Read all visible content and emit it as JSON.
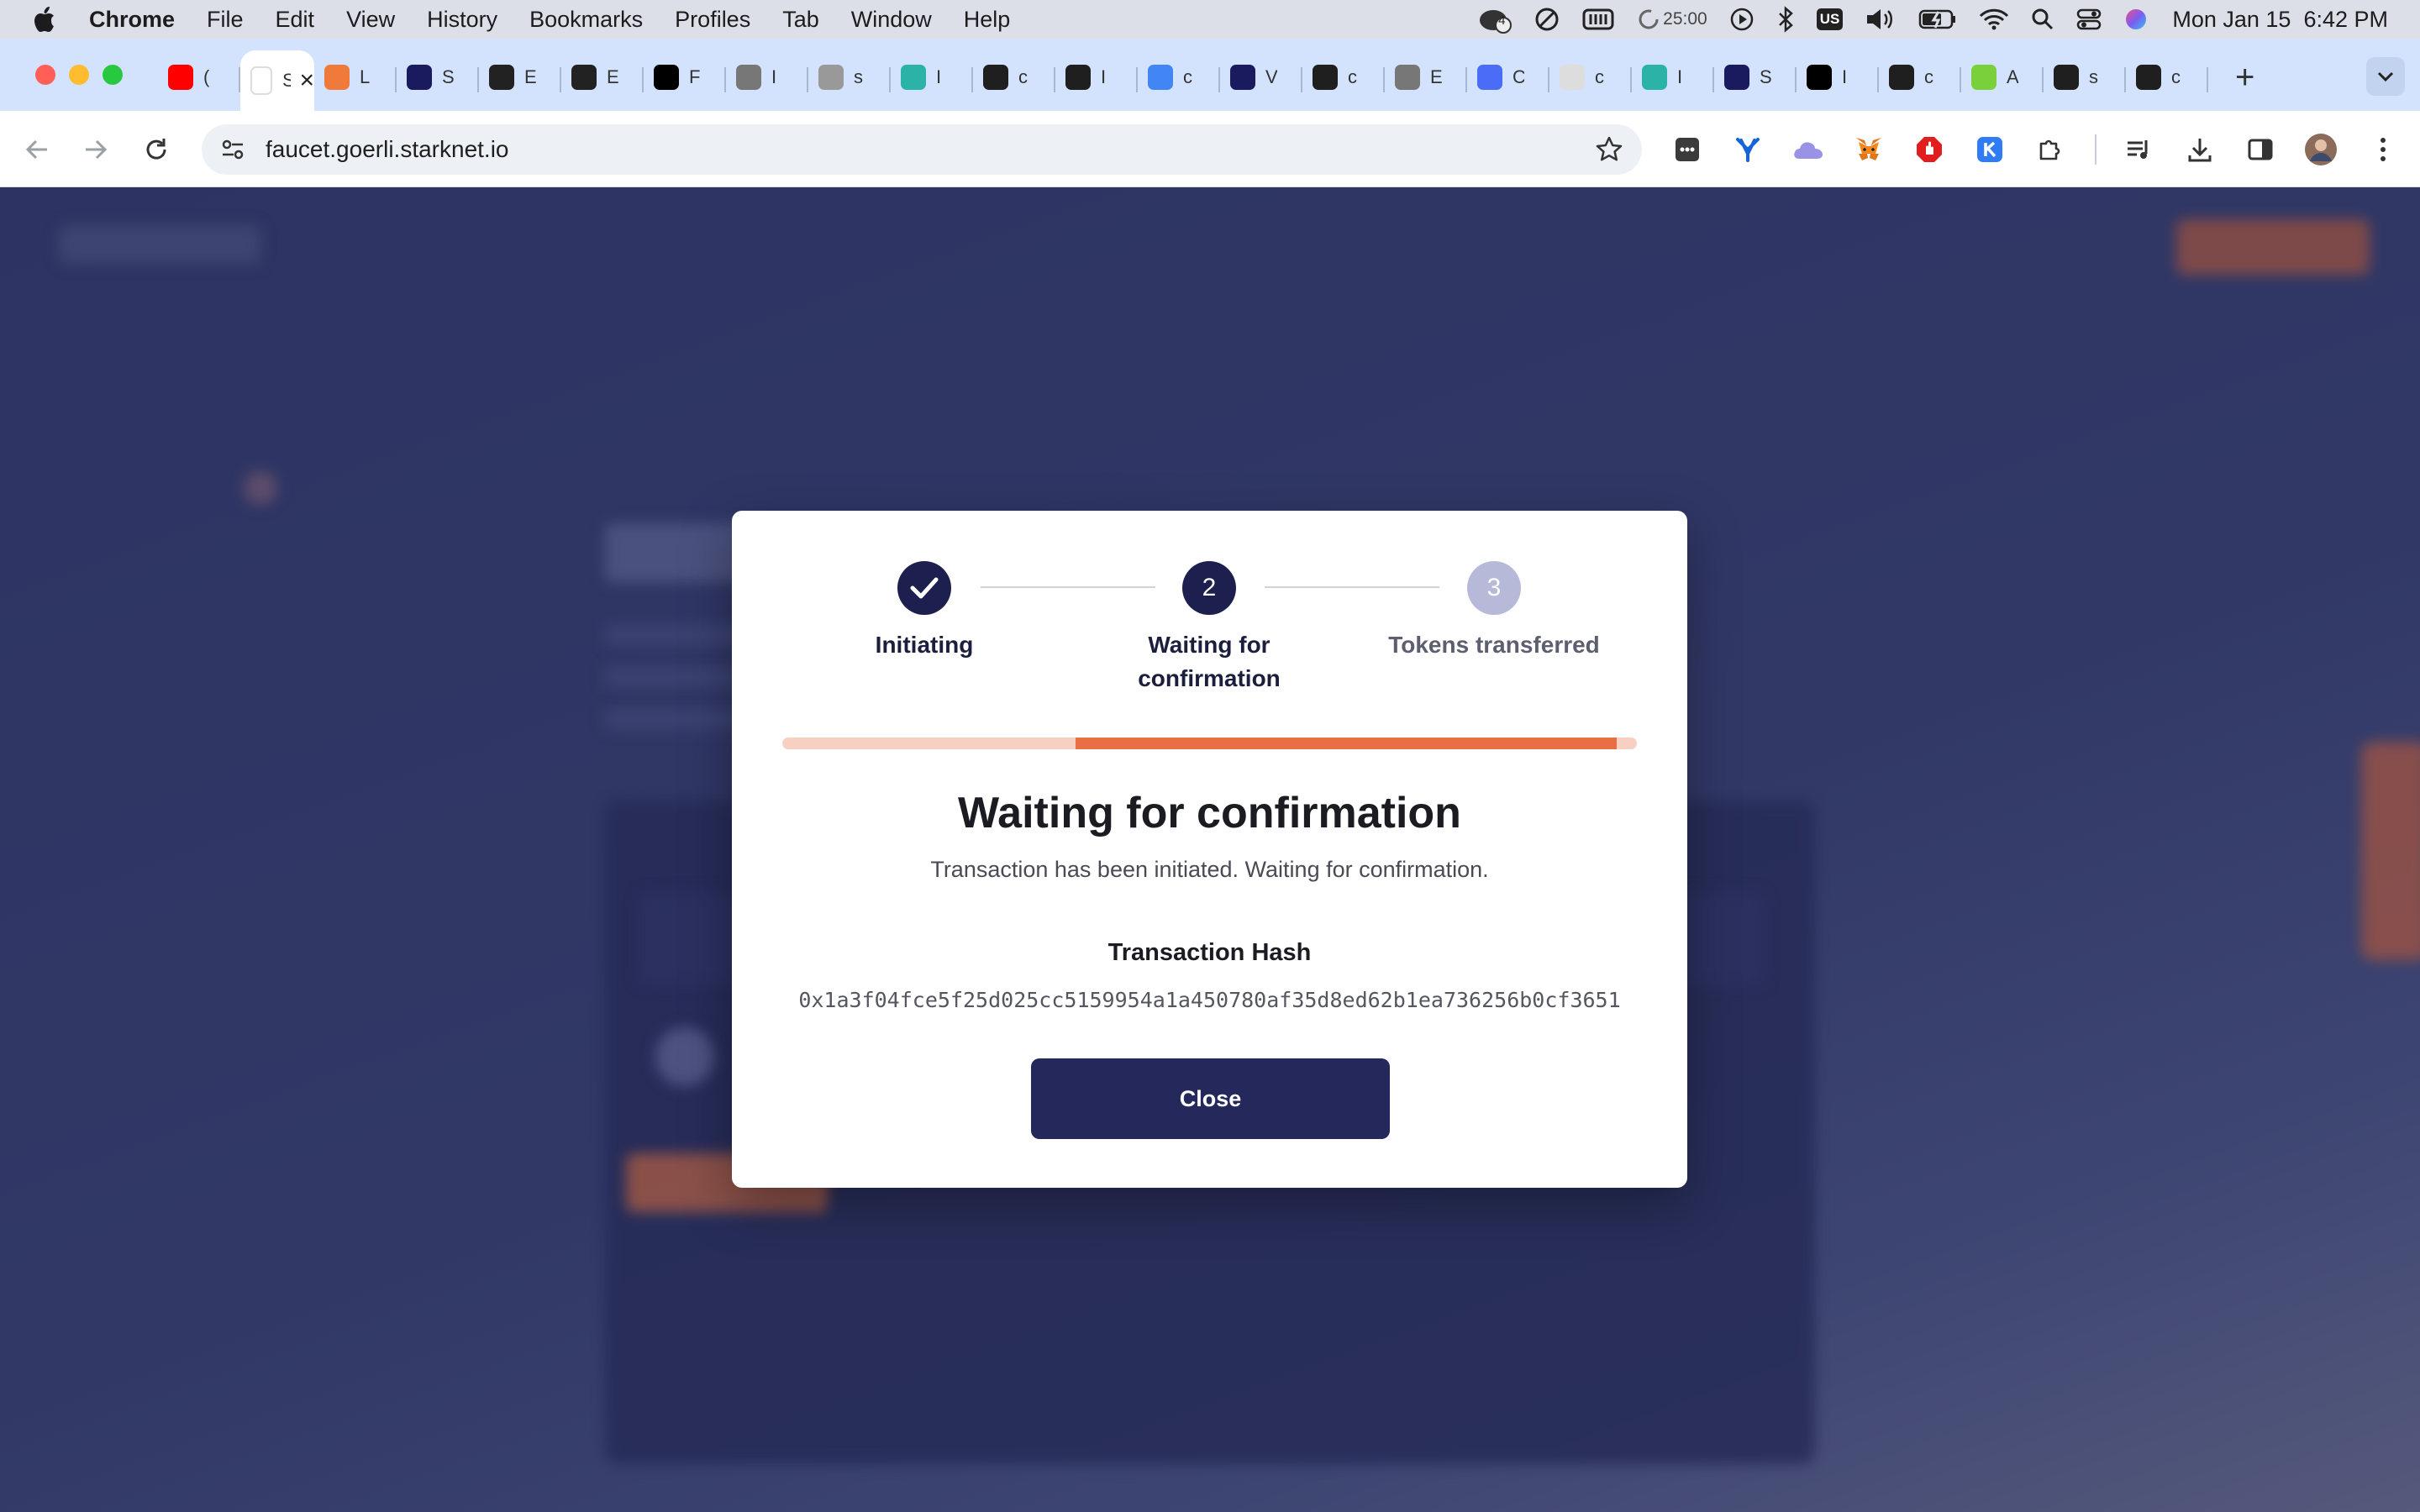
{
  "menubar": {
    "app": "Chrome",
    "items": [
      "File",
      "Edit",
      "View",
      "History",
      "Bookmarks",
      "Profiles",
      "Tab",
      "Window",
      "Help"
    ],
    "timer": "25:00",
    "badge_count": "4",
    "keyboard_layout": "US",
    "datetime": "Mon Jan 15  6:42 PM"
  },
  "tabs": [
    {
      "icon": "youtube-icon",
      "label": "(",
      "color": "#ff0000"
    },
    {
      "icon": "starknet-icon",
      "label": "S",
      "active": true
    },
    {
      "icon": "arbitrum-icon",
      "label": "L",
      "color": "#f07a3a"
    },
    {
      "icon": "starknet-icon",
      "label": "S",
      "color": "#1a1a5e"
    },
    {
      "icon": "eth-icon",
      "label": "E",
      "color": "#222222"
    },
    {
      "icon": "eth-icon",
      "label": "E",
      "color": "#222222"
    },
    {
      "icon": "nft-storage-icon",
      "label": "F",
      "color": "#000000"
    },
    {
      "icon": "globe-icon",
      "label": "I",
      "color": "#777777"
    },
    {
      "icon": "globe-icon",
      "label": "s",
      "color": "#999999"
    },
    {
      "icon": "moralis-icon",
      "label": "I",
      "color": "#2ab3a6"
    },
    {
      "icon": "github-icon",
      "label": "c",
      "color": "#1f1f1f"
    },
    {
      "icon": "github-icon",
      "label": "I",
      "color": "#1f1f1f"
    },
    {
      "icon": "google-icon",
      "label": "c",
      "color": "#4285f4"
    },
    {
      "icon": "wallet-icon",
      "label": "V",
      "color": "#1a1a5e"
    },
    {
      "icon": "github-icon",
      "label": "c",
      "color": "#1f1f1f"
    },
    {
      "icon": "globe-icon",
      "label": "E",
      "color": "#777777"
    },
    {
      "icon": "zksync-icon",
      "label": "C",
      "color": "#4a6cf7"
    },
    {
      "icon": "cube-icon",
      "label": "c",
      "color": "#dddddd"
    },
    {
      "icon": "moralis-icon",
      "label": "I",
      "color": "#2ab3a6"
    },
    {
      "icon": "starknet-icon",
      "label": "S",
      "color": "#1a1a5e"
    },
    {
      "icon": "medium-icon",
      "label": "I",
      "color": "#000000"
    },
    {
      "icon": "github-icon",
      "label": "c",
      "color": "#1f1f1f"
    },
    {
      "icon": "app-icon",
      "label": "A",
      "color": "#7ad03a"
    },
    {
      "icon": "github-icon",
      "label": "s",
      "color": "#1f1f1f"
    },
    {
      "icon": "github-icon",
      "label": "c",
      "color": "#1f1f1f"
    }
  ],
  "toolbar": {
    "url": "faucet.goerli.starknet.io"
  },
  "modal": {
    "steps": [
      {
        "number": "1",
        "label": "Initiating",
        "state": "done"
      },
      {
        "number": "2",
        "label": "Waiting for confirmation",
        "state": "active"
      },
      {
        "number": "3",
        "label": "Tokens transferred",
        "state": "pending"
      }
    ],
    "progress": {
      "start_fraction": 0.343,
      "end_fraction": 0.976
    },
    "title": "Waiting for confirmation",
    "subtitle": "Transaction has been initiated. Waiting for confirmation.",
    "hash_label": "Transaction Hash",
    "hash": "0x1a3f04fce5f25d025cc5159954a1a450780af35d8ed62b1ea736256b0cf3651",
    "close_label": "Close"
  },
  "colors": {
    "navy": "#1d1f4f",
    "pending_step": "#b7b9d8",
    "accent": "#ea6e43",
    "accent_light": "#f8d0c1",
    "button": "#24285b"
  }
}
